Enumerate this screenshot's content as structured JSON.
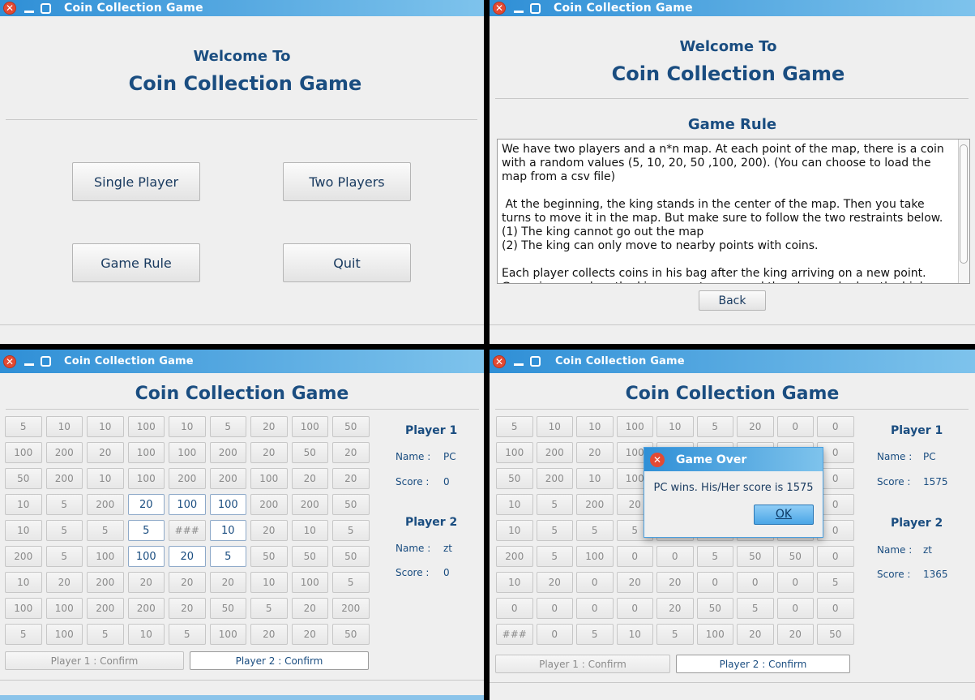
{
  "window_title": "Coin Collection Game",
  "welcome": {
    "line1": "Welcome To",
    "line2": "Coin Collection Game",
    "buttons": {
      "single": "Single Player",
      "two": "Two Players",
      "rule": "Game Rule",
      "quit": "Quit"
    }
  },
  "rules": {
    "heading": "Game Rule",
    "text": "We have two players and a n*n map. At each point of the map, there is a coin with a random values (5, 10, 20, 50 ,100, 200). (You can choose to load the map from a csv file)\n\n At the beginning, the king stands in the center of the map. Then you take turns to move it in the map. But make sure to follow the two restraints below.\n(1) The king cannot go out the map\n(2) The king can only move to nearby points with coins.\n\nEach player collects coins in his bag after the king arriving on a new point. Game is over when the king cannot move and the player who has the higher value of coins wins.",
    "back": "Back"
  },
  "game": {
    "title": "Coin Collection Game",
    "player1": {
      "label": "Player 1",
      "name_label": "Name :",
      "score_label": "Score :"
    },
    "player2": {
      "label": "Player 2",
      "name_label": "Name :",
      "score_label": "Score :"
    },
    "confirm1": "Player 1 : Confirm",
    "confirm2": "Player 2 : Confirm"
  },
  "game_a": {
    "p1_name": "PC",
    "p1_score": "0",
    "p2_name": "zt",
    "p2_score": "0",
    "board": [
      [
        "5",
        "10",
        "10",
        "100",
        "10",
        "5",
        "20",
        "100",
        "50"
      ],
      [
        "100",
        "200",
        "20",
        "100",
        "100",
        "200",
        "20",
        "50",
        "20"
      ],
      [
        "50",
        "200",
        "10",
        "100",
        "200",
        "200",
        "100",
        "20",
        "20"
      ],
      [
        "10",
        "5",
        "200",
        "20",
        "100",
        "100",
        "200",
        "200",
        "50"
      ],
      [
        "10",
        "5",
        "5",
        "5",
        "###",
        "10",
        "20",
        "10",
        "5"
      ],
      [
        "200",
        "5",
        "100",
        "100",
        "20",
        "5",
        "50",
        "50",
        "50"
      ],
      [
        "10",
        "20",
        "200",
        "20",
        "20",
        "20",
        "10",
        "100",
        "5"
      ],
      [
        "100",
        "100",
        "200",
        "200",
        "20",
        "50",
        "5",
        "20",
        "200"
      ],
      [
        "5",
        "100",
        "5",
        "10",
        "5",
        "100",
        "20",
        "20",
        "50"
      ]
    ],
    "active": [
      [
        3,
        3
      ],
      [
        3,
        4
      ],
      [
        3,
        5
      ],
      [
        4,
        3
      ],
      [
        4,
        5
      ],
      [
        5,
        3
      ],
      [
        5,
        4
      ],
      [
        5,
        5
      ]
    ]
  },
  "game_b": {
    "p1_name": "PC",
    "p1_score": "1575",
    "p2_name": "zt",
    "p2_score": "1365",
    "board": [
      [
        "5",
        "10",
        "10",
        "100",
        "10",
        "5",
        "20",
        "0",
        "0"
      ],
      [
        "100",
        "200",
        "20",
        "100",
        "",
        "",
        "",
        "",
        "0"
      ],
      [
        "50",
        "200",
        "10",
        "100",
        "",
        "",
        "",
        "",
        "0"
      ],
      [
        "10",
        "5",
        "200",
        "20",
        "",
        "",
        "",
        "",
        "0"
      ],
      [
        "10",
        "5",
        "5",
        "5",
        "",
        "",
        "",
        "",
        "0"
      ],
      [
        "200",
        "5",
        "100",
        "0",
        "0",
        "5",
        "50",
        "50",
        "0"
      ],
      [
        "10",
        "20",
        "0",
        "20",
        "20",
        "0",
        "0",
        "0",
        "5"
      ],
      [
        "0",
        "0",
        "0",
        "0",
        "20",
        "50",
        "5",
        "0",
        "0"
      ],
      [
        "###",
        "0",
        "5",
        "10",
        "5",
        "100",
        "20",
        "20",
        "50"
      ]
    ],
    "dialog": {
      "title": "Game Over",
      "message": "PC wins. His/Her score is 1575",
      "ok": "OK"
    }
  },
  "icons": [
    "close-icon",
    "minimize-icon",
    "maximize-icon"
  ]
}
